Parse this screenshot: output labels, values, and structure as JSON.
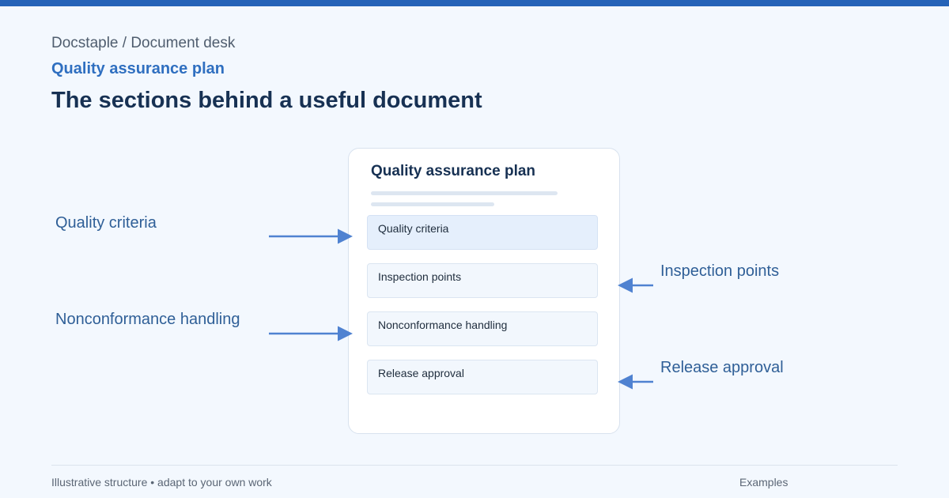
{
  "header": {
    "breadcrumb": "Docstaple / Document desk",
    "eyebrow": "Quality assurance plan",
    "title": "The sections behind a useful document"
  },
  "document": {
    "title": "Quality assurance plan",
    "sections": [
      "Quality criteria",
      "Inspection points",
      "Nonconformance handling",
      "Release approval"
    ],
    "highlighted_section": "Quality criteria"
  },
  "callouts": {
    "left": [
      "Quality criteria",
      "Nonconformance handling"
    ],
    "right": [
      "Inspection points",
      "Release approval"
    ]
  },
  "footer": {
    "note": "Illustrative structure • adapt to your own work",
    "link": "Examples"
  },
  "colors": {
    "accent": "#2563b8",
    "arrow": "#4f82d1",
    "heading": "#173153"
  }
}
